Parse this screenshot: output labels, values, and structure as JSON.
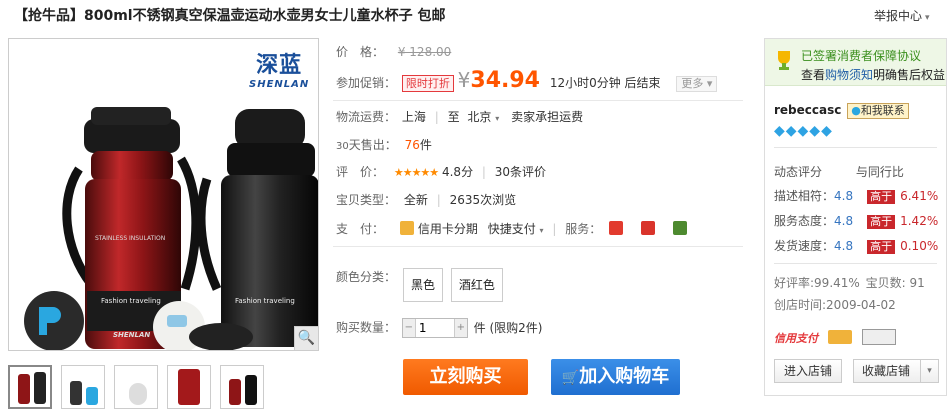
{
  "title": "【抢牛品】800ml不锈钢真空保温壶运动水壶男女士儿童水杯子 包邮",
  "report_label": "举报中心",
  "brand": {
    "name_zh": "深蓝",
    "name_en": "SHENLAN"
  },
  "product_print": {
    "line1": "STAINLESS INSULATION",
    "line2": "Fashion traveling",
    "logo": "SHENLAN"
  },
  "price": {
    "label": "价　格：",
    "original": "¥ 128.00",
    "promo_label": "参加促销：",
    "promo_tag": "限时打折",
    "currency": "¥",
    "current": "34.94",
    "countdown": "12小时0分钟 后结束",
    "more": "更多"
  },
  "shipping": {
    "label": "物流运费：",
    "from": "上海",
    "to_sep": "至",
    "to": "北京",
    "note": "卖家承担运费"
  },
  "sales": {
    "label_prefix": "30",
    "label": "天售出：",
    "count": "76",
    "unit": "件"
  },
  "review": {
    "label": "评　价：",
    "stars": "★★★★★",
    "score": "4.8分",
    "count": "30条评价"
  },
  "baby_type": {
    "label": "宝贝类型：",
    "condition": "全新",
    "views": "2635次浏览"
  },
  "payment": {
    "label": "支　付：",
    "installment": "信用卡分期",
    "express": "快捷支付",
    "service_label": "服务："
  },
  "colors": {
    "label": "颜色分类：",
    "options": [
      "黑色",
      "酒红色"
    ]
  },
  "quantity": {
    "label": "购买数量：",
    "value": "1",
    "unit": "件 (限购2件)"
  },
  "buttons": {
    "buy": "立刻购买",
    "cart": "加入购物车"
  },
  "shop": {
    "guarantee_title": "已签署消费者保障协议",
    "guarantee_view": "查看",
    "guarantee_link": "购物须知",
    "guarantee_tail": "明确售后权益",
    "seller": "rebeccasc",
    "contact": "和我联系",
    "diamonds": "◆◆◆◆◆",
    "dynamic_label": "动态评分",
    "compare_label": "与同行比",
    "ratings": [
      {
        "label": "描述相符：",
        "score": "4.8",
        "tag": "高于",
        "pct": "6.41%"
      },
      {
        "label": "服务态度：",
        "score": "4.8",
        "tag": "高于",
        "pct": "1.42%"
      },
      {
        "label": "发货速度：",
        "score": "4.8",
        "tag": "高于",
        "pct": "0.10%"
      }
    ],
    "good_rate": "好评率:99.41%",
    "baby_count": "宝贝数: 91",
    "created": "创店时间:2009-04-02",
    "credit": "信用支付",
    "enter_shop": "进入店铺",
    "fav_shop": "收藏店铺"
  },
  "colors_theme": {
    "price": "#ff5500",
    "buy": "#f05a00",
    "cart": "#1f6fd0",
    "tag_red": "#c9272c"
  }
}
